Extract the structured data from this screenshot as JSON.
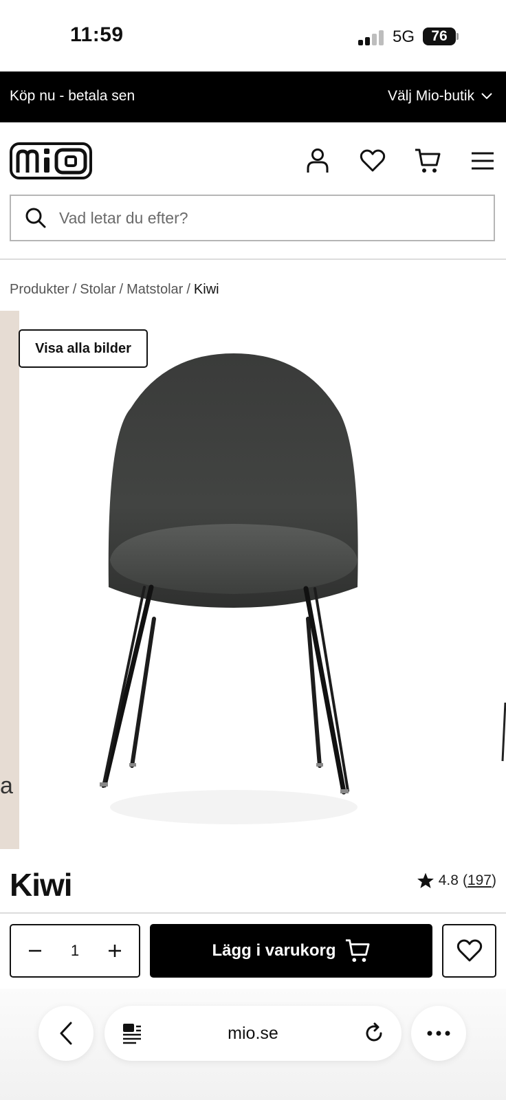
{
  "status_bar": {
    "time": "11:59",
    "network": "5G",
    "battery": "76"
  },
  "promo_bar": {
    "text": "Köp nu - betala sen",
    "store_select": "Välj Mio-butik"
  },
  "header": {
    "logo": "mio",
    "icons": [
      "account-icon",
      "heart-icon",
      "cart-icon",
      "menu-icon"
    ]
  },
  "search": {
    "placeholder": "Vad letar du efter?",
    "value": ""
  },
  "breadcrumb": {
    "items": [
      "Produkter",
      "Stolar",
      "Matstolar"
    ],
    "separator": "/",
    "current": "Kiwi"
  },
  "gallery": {
    "view_all_label": "Visa alla bilder",
    "prev_slide_peek_text": "a"
  },
  "product": {
    "title": "Kiwi",
    "rating": "4.8",
    "review_count_open": "(",
    "review_count": "197",
    "review_count_close": ")"
  },
  "purchase": {
    "quantity": "1",
    "add_to_cart_label": "Lägg i varukorg"
  },
  "browser": {
    "url": "mio.se"
  },
  "colors": {
    "primary": "#000000",
    "promo_bg": "#000000",
    "gallery_side_panel": "#e6dcd3",
    "border": "#b5b5b5"
  }
}
